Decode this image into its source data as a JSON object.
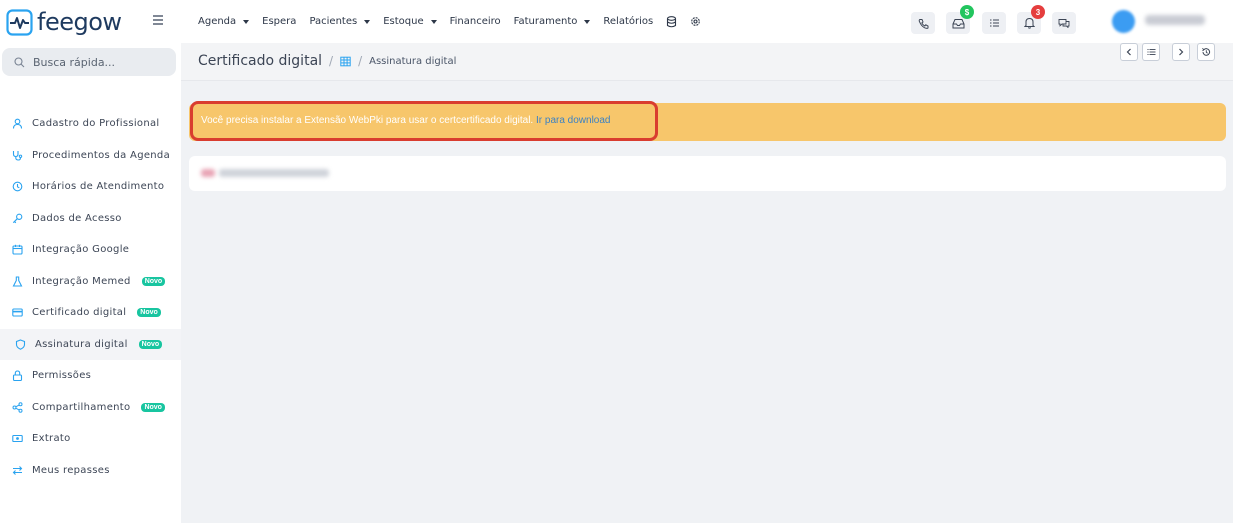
{
  "app": {
    "name": "feegow",
    "accent_color": "#1e3a5f",
    "icon_accent": "#2aa3f0"
  },
  "nav": {
    "items": [
      {
        "label": "Agenda",
        "dropdown": true
      },
      {
        "label": "Espera",
        "dropdown": false
      },
      {
        "label": "Pacientes",
        "dropdown": true
      },
      {
        "label": "Estoque",
        "dropdown": true
      },
      {
        "label": "Financeiro",
        "dropdown": false
      },
      {
        "label": "Faturamento",
        "dropdown": true
      },
      {
        "label": "Relatórios",
        "dropdown": false
      }
    ],
    "badges": {
      "dollar": "$",
      "notifications": "3"
    }
  },
  "search": {
    "placeholder": "Busca rápida..."
  },
  "sidebar": {
    "items": [
      {
        "label": "Cadastro do Profissional",
        "icon": "user-icon"
      },
      {
        "label": "Procedimentos da Agenda",
        "icon": "stethoscope-icon"
      },
      {
        "label": "Horários de Atendimento",
        "icon": "clock-icon"
      },
      {
        "label": "Dados de Acesso",
        "icon": "key-icon"
      },
      {
        "label": "Integração Google",
        "icon": "calendar-icon"
      },
      {
        "label": "Integração Memed",
        "icon": "flask-icon",
        "badge": "Novo"
      },
      {
        "label": "Certificado digital",
        "icon": "card-icon",
        "badge": "Novo"
      },
      {
        "label": "Assinatura digital",
        "icon": "shield-icon",
        "badge": "Novo",
        "active": true
      },
      {
        "label": "Permissões",
        "icon": "lock-icon"
      },
      {
        "label": "Compartilhamento",
        "icon": "share-icon",
        "badge": "Novo"
      },
      {
        "label": "Extrato",
        "icon": "money-icon"
      },
      {
        "label": "Meus repasses",
        "icon": "transfer-icon"
      }
    ]
  },
  "page": {
    "title": "Certificado digital",
    "separator": "/",
    "subtitle": "Assinatura digital"
  },
  "alert": {
    "message": "Você precisa instalar a Extensão WebPki para usar o certcertificado digital.",
    "link": "Ir para download",
    "color": "#f7c66b",
    "highlight_color": "#d93d2f"
  }
}
